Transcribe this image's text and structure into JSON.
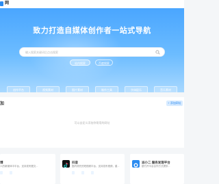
{
  "header": {
    "logo_text": "网"
  },
  "hero": {
    "title": "致力打造自媒体创作者一站式导航",
    "search_placeholder": "输入搜索关键词后点击搜索",
    "primary_button": "站内搜索",
    "secondary_button": "百度搜索",
    "categories": [
      "创作平台",
      "视频素材",
      "图片素材",
      "制作工具",
      "字体配乐",
      "音乐素材"
    ]
  },
  "section": {
    "title": "加",
    "action_label": "+ 添加网址",
    "empty_text": "可以自定义添加你常用的网址"
  },
  "cards": [
    {
      "title": "博",
      "desc": "人的新媒体中平台，支持发布图文...",
      "tags": [
        "",
        ""
      ]
    },
    {
      "title": "抖音",
      "desc": "国内领先的短视频平台，支持发布视频，星...",
      "icon": "douyin-icon",
      "tags": [
        "",
        "",
        ""
      ]
    },
    {
      "title": "派小二 服务发现平台",
      "desc": "银行开平台合作方式提供...",
      "icon": "paixiaoer-icon",
      "tags": []
    }
  ],
  "colors": {
    "accent": "#2d8cf0",
    "hero_top": "#4aa6ff",
    "hero_bottom": "#a8d8ff"
  }
}
